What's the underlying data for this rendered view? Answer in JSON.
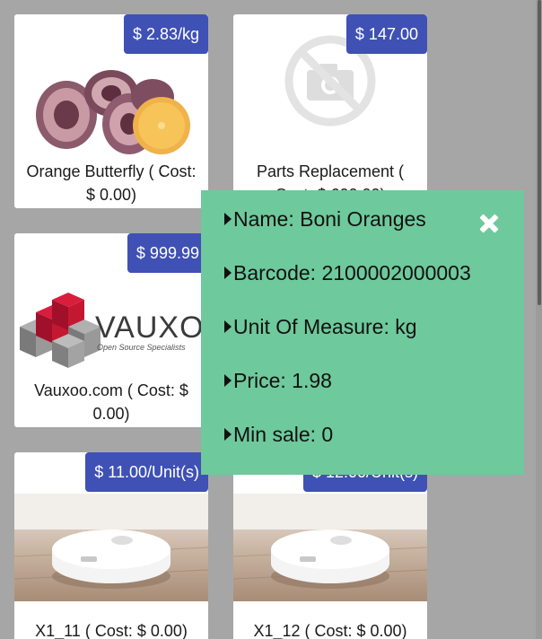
{
  "products": [
    {
      "name": "Orange Butterfly ( Cost: $ 0.00)",
      "price": "$ 2.83/kg"
    },
    {
      "name": "Parts Replacement ( Cost: $ 600.00)",
      "price": "$ 147.00"
    },
    {
      "name": "Vauxoo.com ( Cost: $ 0.00)",
      "price": "$ 999.99",
      "logo_text": "VAUXOO",
      "logo_tagline": "Open Source Specialists"
    },
    {
      "name": "X1_11 ( Cost: $ 0.00)",
      "price": "$ 11.00/Unit(s)"
    },
    {
      "name": "X1_12 ( Cost: $ 0.00)",
      "price": "$ 12.00/Unit(s)"
    }
  ],
  "popup": {
    "name": "Name: Boni Oranges",
    "barcode": "Barcode: 2100002000003",
    "uom": "Unit Of Measure: kg",
    "price": "Price: 1.98",
    "min_sale": "Min sale: 0"
  },
  "colors": {
    "badge": "#3f51b5",
    "popup": "#6ec99c",
    "background": "#a6a6a6"
  },
  "icons": {
    "close": "close-icon",
    "caret": "caret-right-icon",
    "no_image": "no-photo-icon"
  }
}
